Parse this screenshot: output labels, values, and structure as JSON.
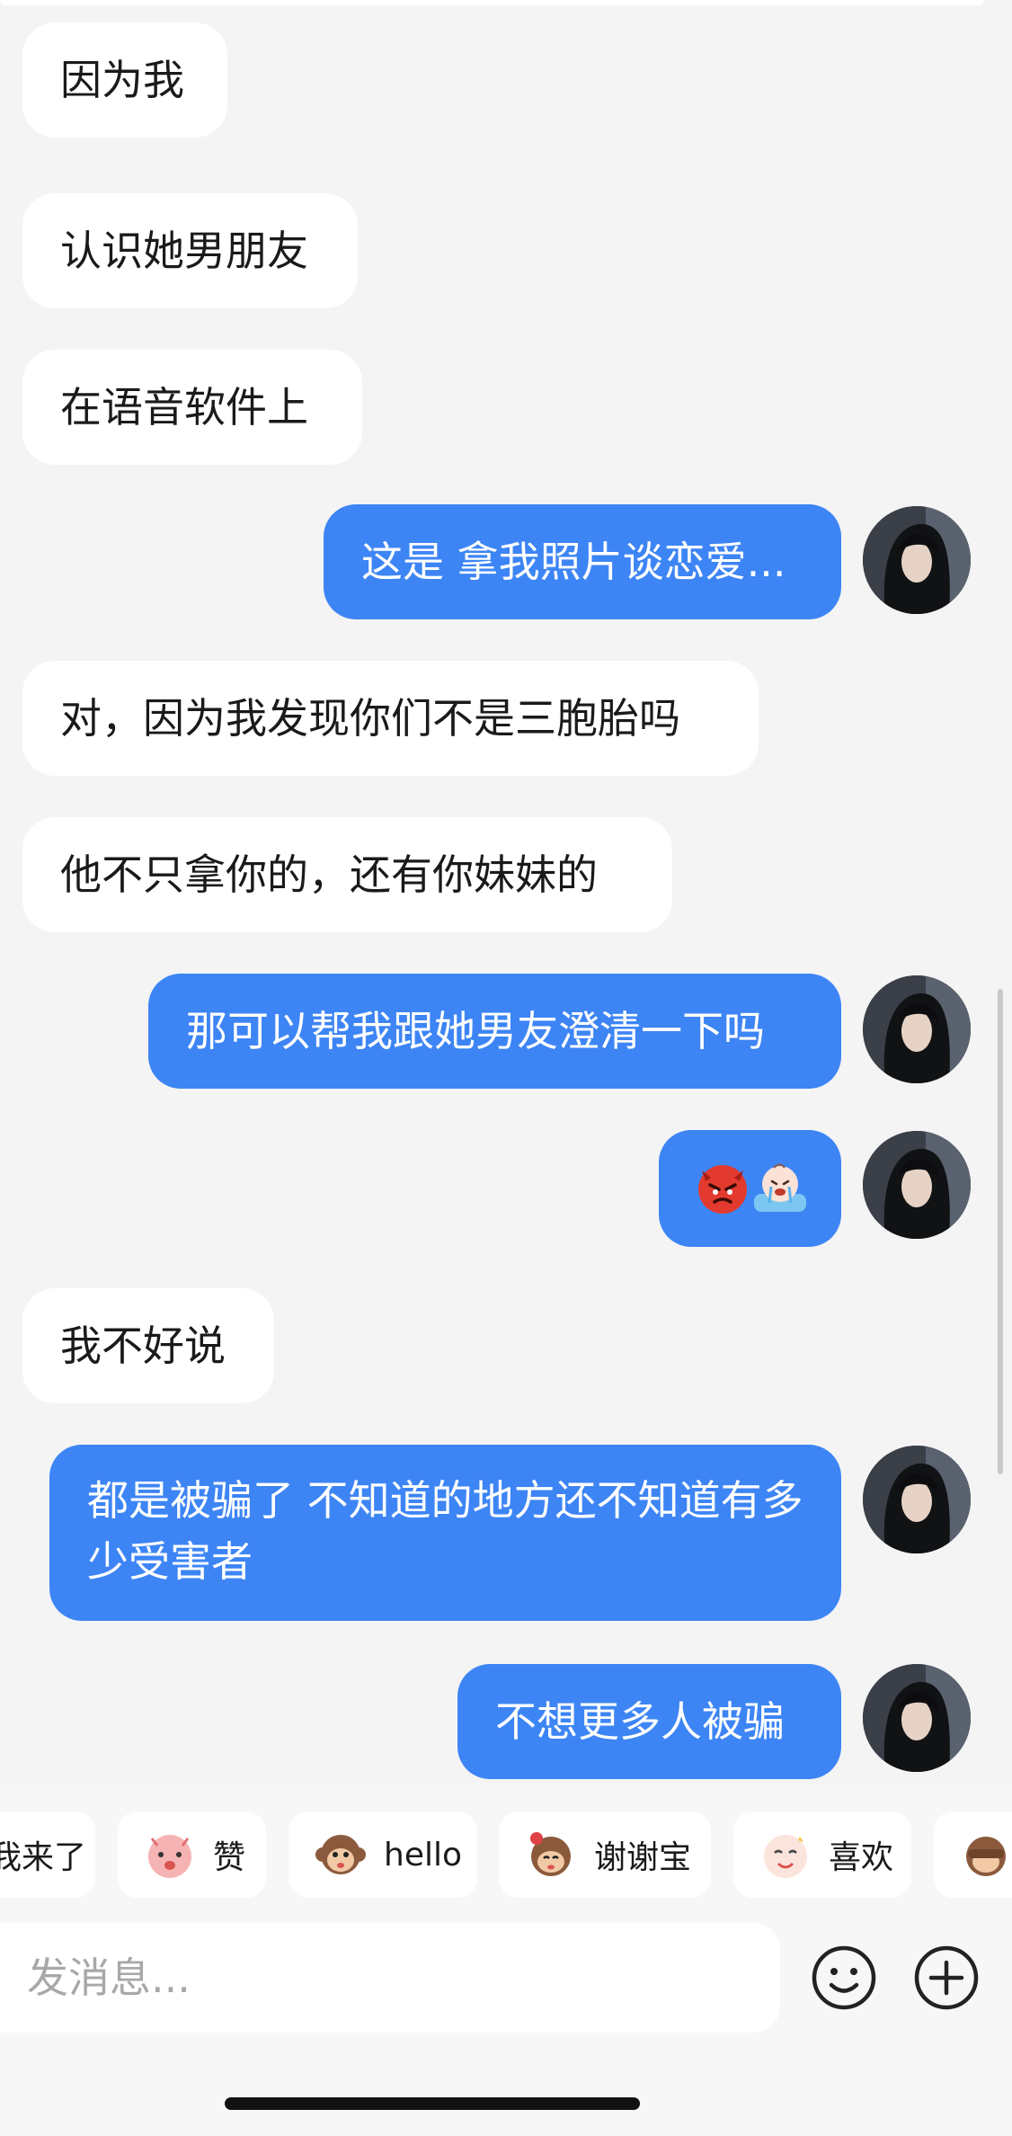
{
  "messages": [
    {
      "side": "in",
      "text": "因为我"
    },
    {
      "side": "in",
      "text": "认识她男朋友"
    },
    {
      "side": "in",
      "text": "在语音软件上"
    },
    {
      "side": "out",
      "text": "这是 拿我照片谈恋爱..."
    },
    {
      "side": "in",
      "text": "对，因为我发现你们不是三胞胎吗"
    },
    {
      "side": "in",
      "text": "他不只拿你的，还有你妹妹的"
    },
    {
      "side": "out",
      "text": "那可以帮我跟她男友澄清一下吗"
    },
    {
      "side": "out",
      "text": "",
      "stickers": [
        "angry-face-sticker",
        "crying-baby-sticker"
      ]
    },
    {
      "side": "in",
      "text": "我不好说"
    },
    {
      "side": "out",
      "text": "都是被骗了 不知道的地方还不知道有多少受害者"
    },
    {
      "side": "out",
      "text": "不想更多人被骗"
    }
  ],
  "quick_replies": [
    {
      "label": "我来了",
      "icon": "arrive-sticker-icon"
    },
    {
      "label": "赞",
      "icon": "like-sticker-icon"
    },
    {
      "label": "hello",
      "icon": "monkey-hello-icon"
    },
    {
      "label": "谢谢宝",
      "icon": "thanks-monkey-icon"
    },
    {
      "label": "喜欢",
      "icon": "like-bubble-icon"
    },
    {
      "label": "",
      "icon": "monkey-cover-eyes-icon"
    }
  ],
  "input": {
    "placeholder": "发消息..."
  },
  "toolbar": {
    "emoji_icon": "smiley-face-icon",
    "add_icon": "plus-circle-icon"
  },
  "colors": {
    "outgoing_bubble": "#3d85f5",
    "incoming_bubble": "#ffffff",
    "background": "#f4f4f4"
  }
}
